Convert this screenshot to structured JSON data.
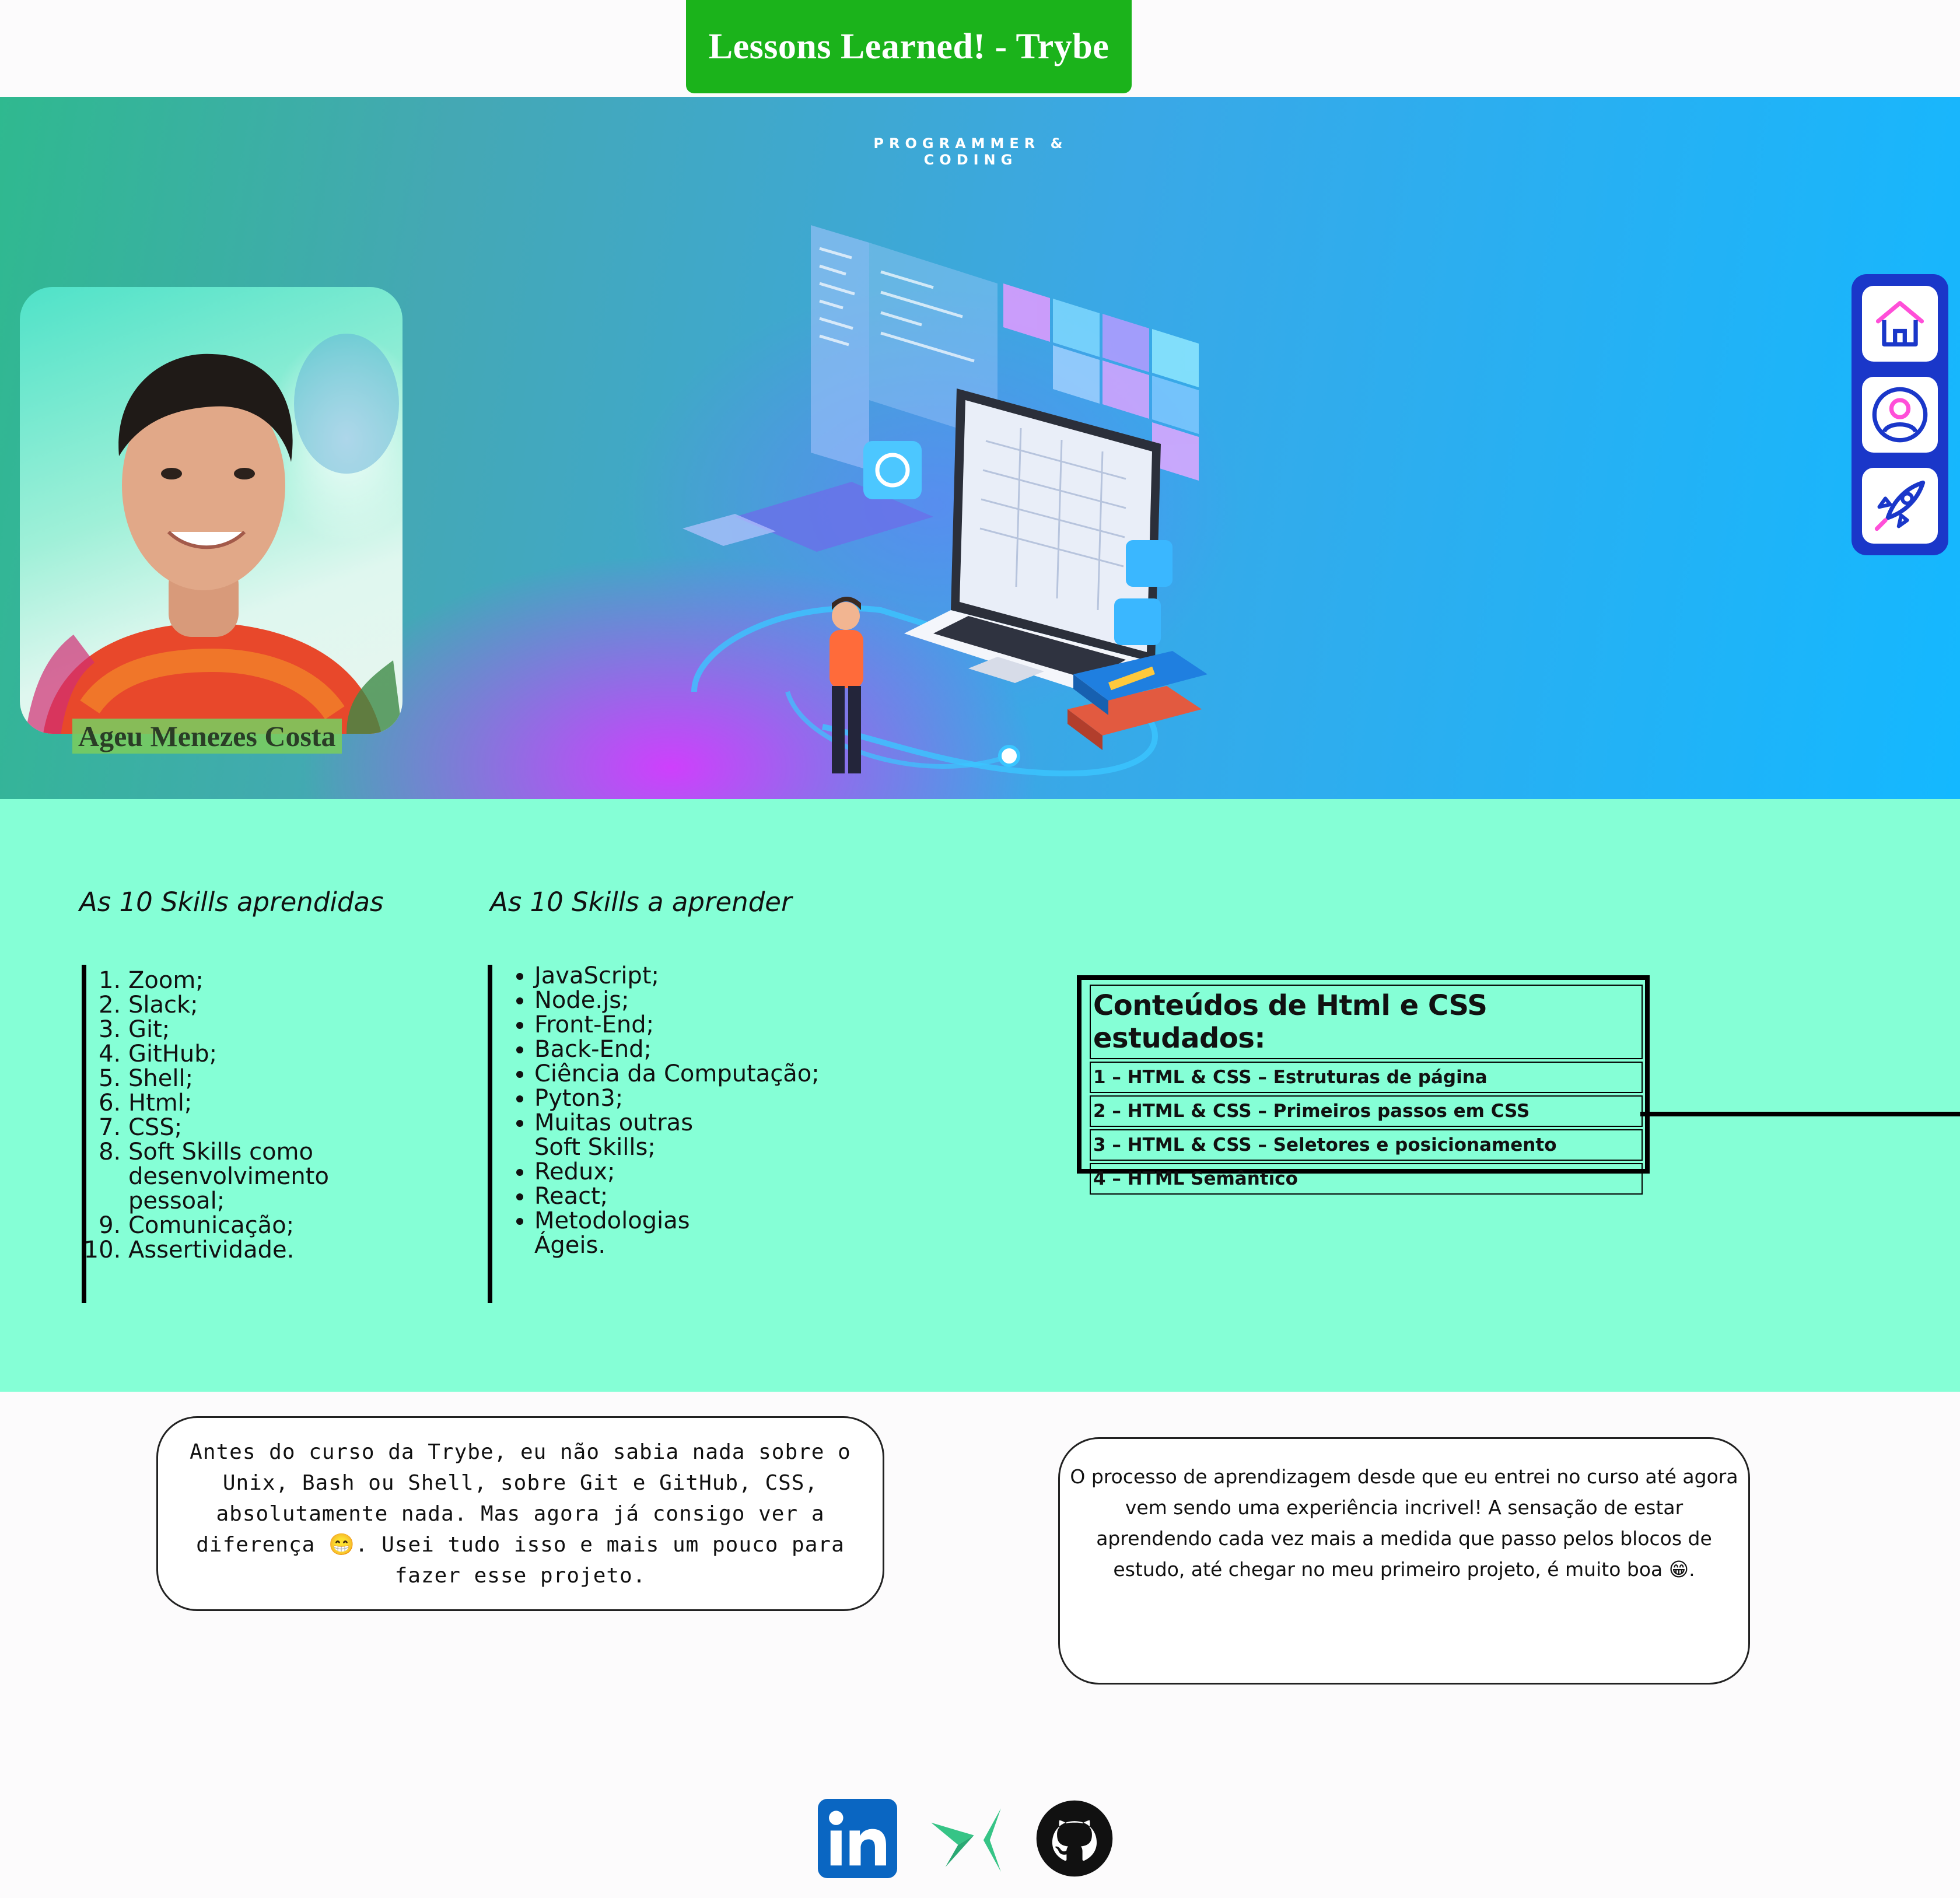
{
  "header": {
    "title": "Lessons Learned! - Trybe"
  },
  "hero": {
    "caption": "PROGRAMMER & CODING",
    "profile_name": "Ageu Menezes Costa"
  },
  "side_nav": {
    "items": [
      {
        "icon": "home-icon",
        "color": "#1a37c9"
      },
      {
        "icon": "user-icon",
        "color": "#1a37c9"
      },
      {
        "icon": "rocket-icon",
        "color": "#1a37c9"
      }
    ]
  },
  "skills": {
    "learned_title": "As 10 Skills aprendidas",
    "learned": [
      "Zoom;",
      "Slack;",
      "Git;",
      "GitHub;",
      "Shell;",
      "Html;",
      "CSS;",
      "Soft Skills como desenvolvimento pessoal;",
      "Comunicação;",
      "Assertividade."
    ],
    "to_learn_title": "As 10 Skills a aprender",
    "to_learn": [
      "JavaScript;",
      "Node.js;",
      "Front-End;",
      "Back-End;",
      "Ciência da Computação;",
      "Pyton3;",
      "Muitas outras Soft Skills;",
      "Redux;",
      "React;",
      "Metodologias Ágeis."
    ],
    "background": "#85ffd6"
  },
  "contents": {
    "title": "Conteúdos de Html e CSS estudados:",
    "rows": [
      "1 – HTML & CSS – Estruturas de página",
      "2 – HTML & CSS – Primeiros passos em CSS",
      "3 – HTML & CSS – Seletores e posicionamento",
      "4 – HTML Semântico"
    ]
  },
  "cards": {
    "before": "Antes do curso da Trybe, eu não sabia nada sobre o Unix, Bash ou Shell, sobre Git e GitHub, CSS, absolutamente nada. Mas agora já consigo ver a diferença 😁. Usei tudo isso e mais um pouco para fazer esse projeto.",
    "process": "O processo de aprendizagem desde que eu entrei no curso até agora vem sendo uma experiência incrivel! A sensação de estar aprendendo cada vez mais a medida que passo pelos blocos de estudo, até chegar no meu primeiro projeto, é muito boa 😁."
  },
  "footer": {
    "links": [
      {
        "icon": "linkedin-icon",
        "color": "#0a66c2"
      },
      {
        "icon": "trybe-icon",
        "color": "#36c486"
      },
      {
        "icon": "github-icon",
        "color": "#111111"
      }
    ]
  },
  "colors": {
    "title_bg": "#1bb31b",
    "nav_bg": "#1a37c9",
    "accent_pink": "#ff4fd8"
  }
}
